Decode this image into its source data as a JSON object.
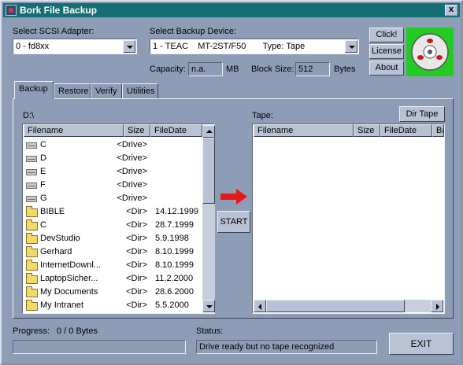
{
  "window": {
    "title": "Bork File Backup",
    "close_label": "x"
  },
  "scsi": {
    "label": "Select SCSI Adapter:",
    "value": "0 - fd8xx"
  },
  "device": {
    "label": "Select Backup Device:",
    "value": "1 - TEAC    MT-2ST/F50       Type: Tape"
  },
  "capacity": {
    "label": "Capacity:",
    "value": "n.a.",
    "unit": "MB"
  },
  "blocksize": {
    "label": "Block Size:",
    "value": "512",
    "unit": "Bytes"
  },
  "buttons": {
    "click": "Click!",
    "license": "License",
    "about": "About",
    "start": "START",
    "dir_tape": "Dir Tape",
    "exit": "EXIT"
  },
  "tabs": [
    "Backup",
    "Restore",
    "Verify",
    "Utilities"
  ],
  "source": {
    "path": "D:\\",
    "columns": [
      "Filename",
      "Size",
      "FileDate"
    ],
    "rows": [
      {
        "name": "C",
        "size": "<Drive>",
        "date": "",
        "kind": "drive"
      },
      {
        "name": "D",
        "size": "<Drive>",
        "date": "",
        "kind": "drive"
      },
      {
        "name": "E",
        "size": "<Drive>",
        "date": "",
        "kind": "drive"
      },
      {
        "name": "F",
        "size": "<Drive>",
        "date": "",
        "kind": "drive"
      },
      {
        "name": "G",
        "size": "<Drive>",
        "date": "",
        "kind": "drive"
      },
      {
        "name": "BIBLE",
        "size": "<Dir>",
        "date": "14.12.1999",
        "kind": "folder"
      },
      {
        "name": "C",
        "size": "<Dir>",
        "date": "28.7.1999",
        "kind": "folder"
      },
      {
        "name": "DevStudio",
        "size": "<Dir>",
        "date": "5.9.1998",
        "kind": "folder"
      },
      {
        "name": "Gerhard",
        "size": "<Dir>",
        "date": "8.10.1999",
        "kind": "folder"
      },
      {
        "name": "InternetDownl...",
        "size": "<Dir>",
        "date": "8.10.1999",
        "kind": "folder"
      },
      {
        "name": "LaptopSicher...",
        "size": "<Dir>",
        "date": "11.2.2000",
        "kind": "folder"
      },
      {
        "name": "My Documents",
        "size": "<Dir>",
        "date": "28.6.2000",
        "kind": "folder"
      },
      {
        "name": "My Intranet",
        "size": "<Dir>",
        "date": "5.5.2000",
        "kind": "folder"
      }
    ]
  },
  "tape": {
    "label": "Tape:",
    "columns": [
      "Filename",
      "Size",
      "FileDate",
      "Ba"
    ]
  },
  "progress": {
    "label": "Progress:",
    "value": "0 / 0 Bytes",
    "fraction": 0
  },
  "status": {
    "label": "Status:",
    "value": "Drive ready but no tape recognized"
  },
  "colors": {
    "titlebar": "#156e73",
    "face": "#8e9db6",
    "logo_bg": "#22cc22",
    "arrow": "#e81818"
  }
}
